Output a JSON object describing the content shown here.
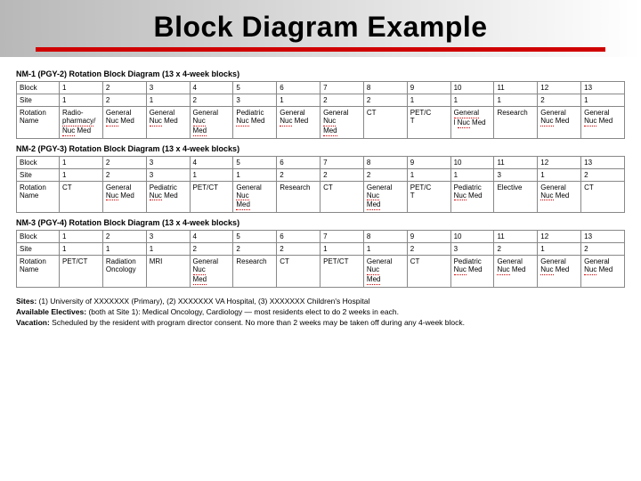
{
  "title": "Block Diagram Example",
  "row_labels": [
    "Block",
    "Site",
    "Rotation Name"
  ],
  "tables": [
    {
      "caption": "NM-1 (PGY-2) Rotation Block Diagram (13 x 4-week blocks)",
      "block": [
        "1",
        "2",
        "3",
        "4",
        "5",
        "6",
        "7",
        "8",
        "9",
        "10",
        "11",
        "12",
        "13"
      ],
      "site": [
        "1",
        "2",
        "1",
        "2",
        "3",
        "1",
        "2",
        "2",
        "1",
        "1",
        "1",
        "2",
        "1"
      ],
      "rotation_html": [
        "Radio-<br><span class='squig'>pharmacy</span>/<br><span class='squig'>Nuc</span> Med",
        "General <span class='squig'>Nuc</span> Med",
        "General <span class='squig'>Nuc</span> Med",
        "General <span class='squig'>Nuc</span><br><span class='squig'>Med</span>",
        "Pediatric <span class='squig'>Nuc</span> Med",
        "General <span class='squig'>Nuc</span> Med",
        "General <span class='squig'>Nuc</span><br><span class='squig'>Med</span>",
        "CT",
        "PET/C<br>T",
        "<span class='squig'>General</span><br>l <span class='squig'>Nuc</span> Med",
        "Research",
        "General <span class='squig'>Nuc</span> Med",
        "General <span class='squig'>Nuc</span> Med"
      ]
    },
    {
      "caption": "NM-2 (PGY-3) Rotation Block Diagram (13 x 4-week blocks)",
      "block": [
        "1",
        "2",
        "3",
        "4",
        "5",
        "6",
        "7",
        "8",
        "9",
        "10",
        "11",
        "12",
        "13"
      ],
      "site": [
        "1",
        "2",
        "3",
        "1",
        "1",
        "2",
        "2",
        "2",
        "1",
        "1",
        "3",
        "1",
        "2"
      ],
      "rotation_html": [
        "CT",
        "General <span class='squig'>Nuc</span> Med",
        "Pediatric <span class='squig'>Nuc</span> Med",
        "PET/CT",
        "General <span class='squig'>Nuc</span><br><span class='squig'>Med</span>",
        "Research",
        "CT",
        "General <span class='squig'>Nuc</span><br><span class='squig'>Med</span>",
        "PET/C<br>T",
        "Pediatric <span class='squig'>Nuc</span> Med",
        "Elective",
        "General <span class='squig'>Nuc</span> Med",
        "CT"
      ]
    },
    {
      "caption": "NM-3 (PGY-4) Rotation Block Diagram (13 x 4-week blocks)",
      "block": [
        "1",
        "2",
        "3",
        "4",
        "5",
        "6",
        "7",
        "8",
        "9",
        "10",
        "11",
        "12",
        "13"
      ],
      "site": [
        "1",
        "1",
        "1",
        "2",
        "2",
        "2",
        "1",
        "1",
        "2",
        "3",
        "2",
        "1",
        "2"
      ],
      "rotation_html": [
        "PET/CT",
        "Radiation Oncology",
        "MRI",
        "General <span class='squig'>Nuc</span><br><span class='squig'>Med</span>",
        "Research",
        "CT",
        "PET/CT",
        "General <span class='squig'>Nuc</span><br><span class='squig'>Med</span>",
        "CT",
        "Pediatric <span class='squig'>Nuc</span> Med",
        "General <span class='squig'>Nuc</span> Med",
        "General <span class='squig'>Nuc</span> Med",
        "General <span class='squig'>Nuc</span> Med"
      ]
    }
  ],
  "footer": {
    "sites_label": "Sites:",
    "sites_text": "(1) University of XXXXXXX (Primary), (2) XXXXXXX VA Hospital, (3) XXXXXXX Children's Hospital",
    "electives_label": "Available Electives:",
    "electives_text": "(both at Site 1): Medical Oncology, Cardiology — most residents elect to do 2 weeks in each.",
    "vacation_label": "Vacation:",
    "vacation_text": "Scheduled by the resident with program director consent. No more than 2 weeks may be taken off during any 4-week block."
  }
}
